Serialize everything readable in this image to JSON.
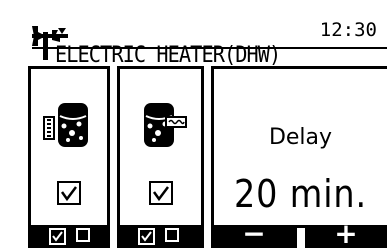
{
  "header": {
    "title": "ELECTRIC HEATER(DHW)",
    "time": "12:30",
    "tools_icon": "tools-icon"
  },
  "panels": [
    {
      "icon": "water-tank-heater-icon",
      "checked": true
    },
    {
      "icon": "booster-heater-icon",
      "checked": true
    }
  ],
  "delay": {
    "label": "Delay",
    "value": "20 min."
  },
  "softkeys": {
    "f1": "check-and-uncheck",
    "f2": "check-and-uncheck",
    "f3": "−",
    "f4": "+"
  }
}
